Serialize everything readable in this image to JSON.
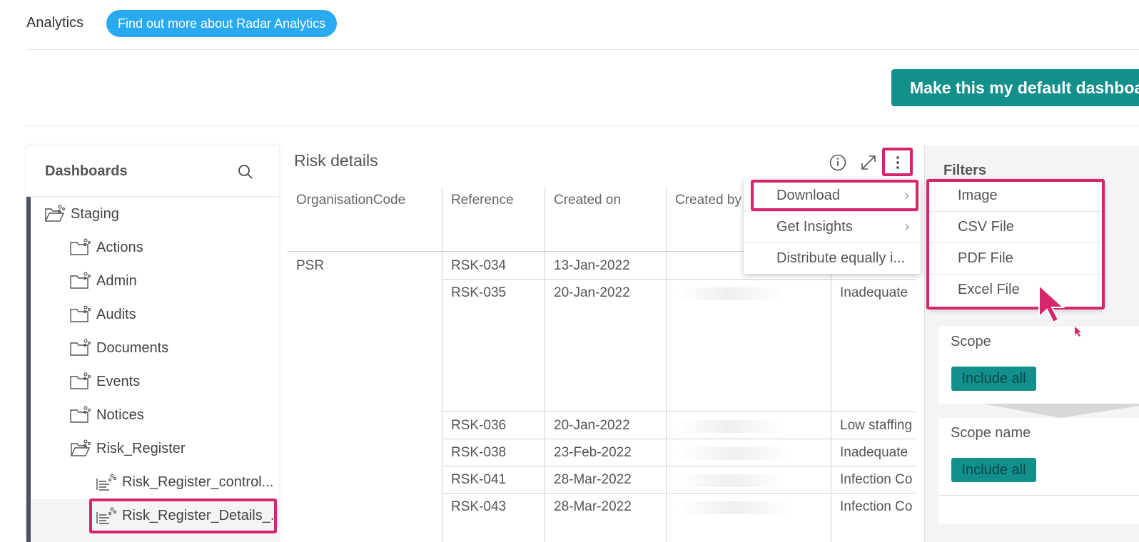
{
  "header": {
    "title": "Analytics",
    "learn_more": "Find out more about Radar Analytics",
    "default_button": "Make this my default dashboard"
  },
  "sidebar": {
    "title": "Dashboards",
    "tree": [
      {
        "label": "Staging",
        "icon": "folder-open-share-icon"
      },
      {
        "label": "Actions",
        "icon": "folder-share-icon"
      },
      {
        "label": "Admin",
        "icon": "folder-share-icon"
      },
      {
        "label": "Audits",
        "icon": "folder-share-icon"
      },
      {
        "label": "Documents",
        "icon": "folder-share-icon"
      },
      {
        "label": "Events",
        "icon": "folder-share-icon"
      },
      {
        "label": "Notices",
        "icon": "folder-share-icon"
      },
      {
        "label": "Risk_Register",
        "icon": "folder-open-share-icon"
      },
      {
        "label": "Risk_Register_control...",
        "icon": "dashboard-share-icon"
      },
      {
        "label": "Risk_Register_Details_...",
        "icon": "dashboard-share-icon"
      }
    ]
  },
  "panel": {
    "title": "Risk details",
    "columns": [
      "OrganisationCode",
      "Reference",
      "Created on",
      "Created by",
      ""
    ],
    "org": "PSR",
    "rows": [
      {
        "reference": "RSK-034",
        "created_on": "13-Jan-2022",
        "created_by": "",
        "desc": ""
      },
      {
        "reference": "RSK-035",
        "created_on": "20-Jan-2022",
        "created_by": "",
        "desc": "Inadequate"
      },
      {
        "reference": "RSK-036",
        "created_on": "20-Jan-2022",
        "created_by": "",
        "desc": "Low staffing"
      },
      {
        "reference": "RSK-038",
        "created_on": "23-Feb-2022",
        "created_by": "",
        "desc": "Inadequate"
      },
      {
        "reference": "RSK-041",
        "created_on": "28-Mar-2022",
        "created_by": "",
        "desc": "Infection Co"
      },
      {
        "reference": "RSK-043",
        "created_on": "28-Mar-2022",
        "created_by": "",
        "desc": "Infection Co"
      }
    ]
  },
  "menu": {
    "items": [
      "Download",
      "Get Insights",
      "Distribute equally i..."
    ],
    "submenu": [
      "Image",
      "CSV File",
      "PDF File",
      "Excel File"
    ]
  },
  "filters": {
    "title": "Filters",
    "scope_label": "Scope",
    "scope_name_label": "Scope name",
    "include_all": "Include all"
  },
  "colors": {
    "accent": "#138f8c",
    "pill": "#29a9f0",
    "highlight": "#d6256b"
  }
}
